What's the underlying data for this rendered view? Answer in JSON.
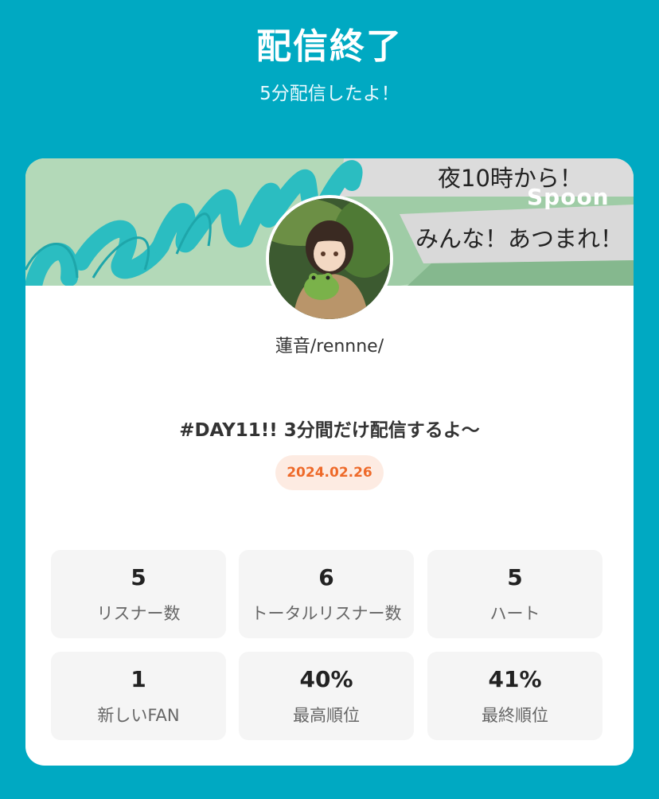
{
  "header": {
    "title": "配信終了",
    "subtitle": "5分配信したよ！"
  },
  "banner": {
    "line1": "夜10時から！",
    "brand": "Spoon",
    "line2": "みんな！あつまれ！",
    "script_text": "rennne"
  },
  "profile": {
    "username": "蓮音/rennne/"
  },
  "broadcast": {
    "title": "#DAY11!! 3分間だけ配信するよ〜",
    "date": "2024.02.26"
  },
  "stats": [
    {
      "value": "5",
      "label": "リスナー数"
    },
    {
      "value": "6",
      "label": "トータルリスナー数"
    },
    {
      "value": "5",
      "label": "ハート"
    },
    {
      "value": "1",
      "label": "新しいFAN"
    },
    {
      "value": "40%",
      "label": "最高順位"
    },
    {
      "value": "41%",
      "label": "最終順位"
    }
  ],
  "colors": {
    "background": "#00a9c2",
    "card": "#ffffff",
    "date_text": "#ee6a2a",
    "date_bg": "#fdebe2",
    "stat_bg": "#f5f5f5"
  }
}
